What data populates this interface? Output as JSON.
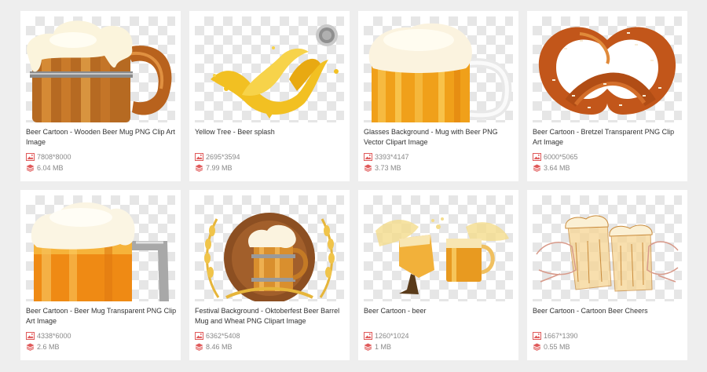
{
  "cards": [
    {
      "title": "Beer Cartoon - Wooden Beer Mug PNG Clip Art Image",
      "dimensions": "7808*8000",
      "size": "6.04 MB",
      "icon": "wooden-beer-mug-image"
    },
    {
      "title": "Yellow Tree - Beer splash",
      "dimensions": "2695*3594",
      "size": "7.99 MB",
      "icon": "beer-splash-image"
    },
    {
      "title": "Glasses Background - Mug with Beer PNG Vector Clipart Image",
      "dimensions": "3393*4147",
      "size": "3.73 MB",
      "icon": "glass-beer-mug-image"
    },
    {
      "title": "Beer Cartoon - Bretzel Transparent PNG Clip Art Image",
      "dimensions": "6000*5065",
      "size": "3.64 MB",
      "icon": "pretzel-image"
    },
    {
      "title": "Beer Cartoon - Beer Mug Transparent PNG Clip Art Image",
      "dimensions": "4338*6000",
      "size": "2.6 MB",
      "icon": "beer-mug-image"
    },
    {
      "title": "Festival Background - Oktoberfest Beer Barrel Mug and Wheat PNG Clipart Image",
      "dimensions": "6362*5408",
      "size": "8.46 MB",
      "icon": "oktoberfest-barrel-image"
    },
    {
      "title": "Beer Cartoon - beer",
      "dimensions": "1260*1024",
      "size": "1 MB",
      "icon": "beer-toast-image"
    },
    {
      "title": "Beer Cartoon - Cartoon Beer Cheers",
      "dimensions": "1667*1390",
      "size": "0.55 MB",
      "icon": "beer-cheers-sketch-image"
    }
  ],
  "colors": {
    "icon_red": "#e05a5a",
    "meta_text": "#888888",
    "background": "#eeeeee"
  }
}
